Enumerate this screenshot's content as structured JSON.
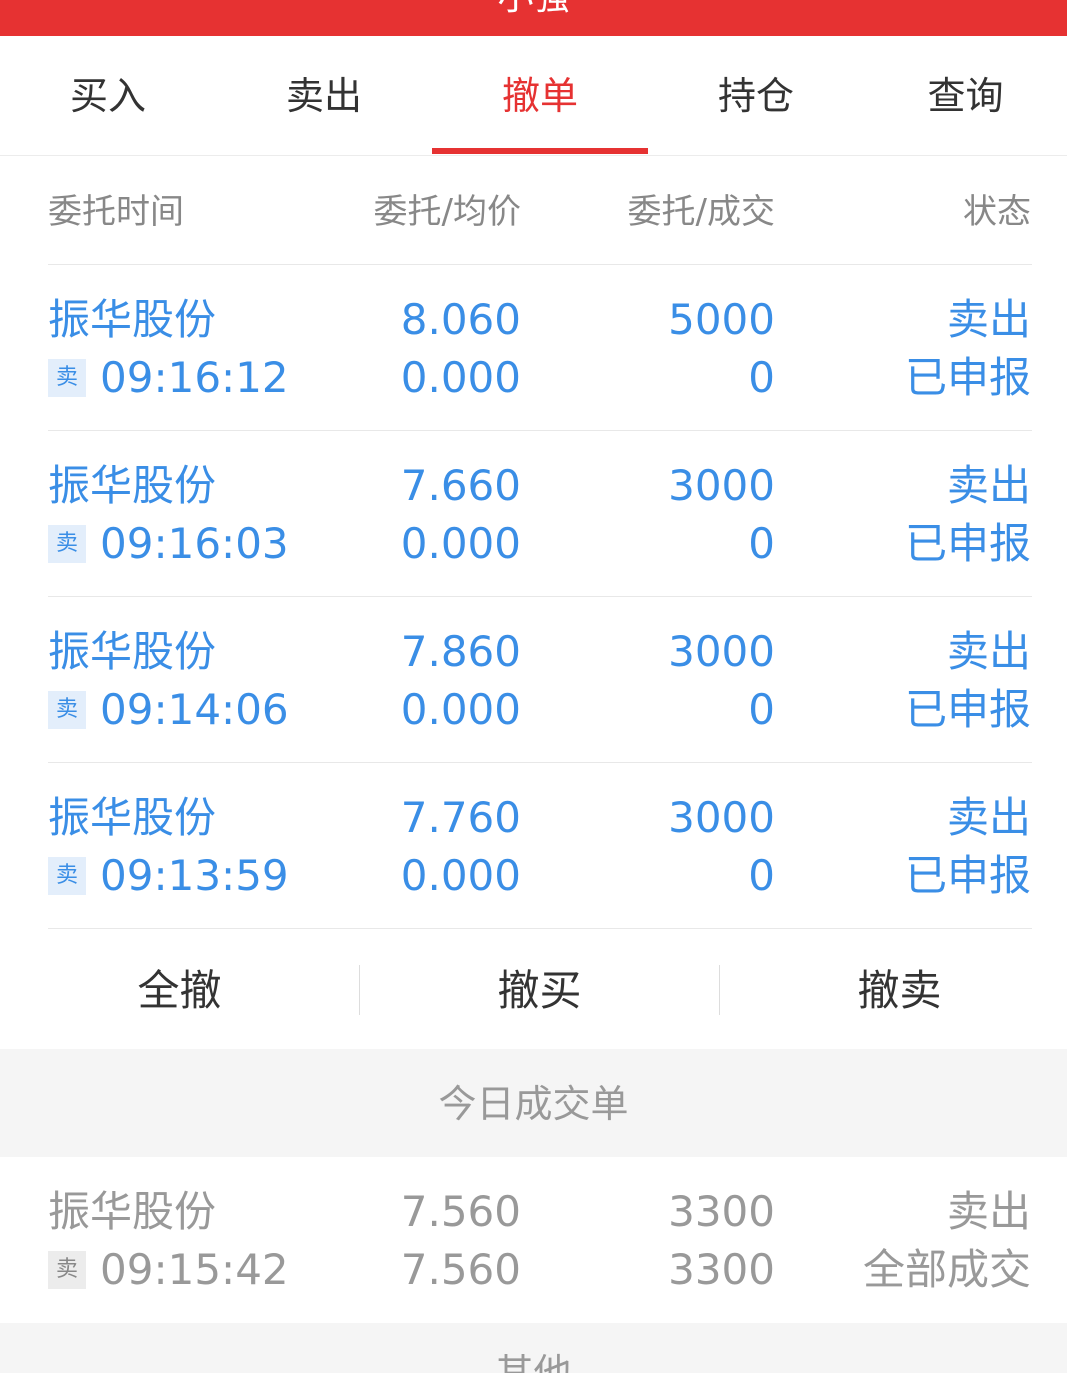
{
  "header": {
    "title": "小强",
    "bg_color": "#e63232"
  },
  "tabs": [
    {
      "label": "买入"
    },
    {
      "label": "卖出"
    },
    {
      "label": "撤单",
      "active": true
    },
    {
      "label": "持仓"
    },
    {
      "label": "查询"
    }
  ],
  "columns": {
    "time": "委托时间",
    "price": "委托/均价",
    "qty": "委托/成交",
    "status": "状态"
  },
  "orders": [
    {
      "name": "振华股份",
      "side_badge": "卖",
      "time": "09:16:12",
      "order_price": "8.060",
      "avg_price": "0.000",
      "order_qty": "5000",
      "filled_qty": "0",
      "direction": "卖出",
      "status": "已申报"
    },
    {
      "name": "振华股份",
      "side_badge": "卖",
      "time": "09:16:03",
      "order_price": "7.660",
      "avg_price": "0.000",
      "order_qty": "3000",
      "filled_qty": "0",
      "direction": "卖出",
      "status": "已申报"
    },
    {
      "name": "振华股份",
      "side_badge": "卖",
      "time": "09:14:06",
      "order_price": "7.860",
      "avg_price": "0.000",
      "order_qty": "3000",
      "filled_qty": "0",
      "direction": "卖出",
      "status": "已申报"
    },
    {
      "name": "振华股份",
      "side_badge": "卖",
      "time": "09:13:59",
      "order_price": "7.760",
      "avg_price": "0.000",
      "order_qty": "3000",
      "filled_qty": "0",
      "direction": "卖出",
      "status": "已申报"
    }
  ],
  "actions": {
    "cancel_all": "全撤",
    "cancel_buy": "撤买",
    "cancel_sell": "撤卖"
  },
  "today_trades": {
    "title": "今日成交单",
    "items": [
      {
        "name": "振华股份",
        "side_badge": "卖",
        "time": "09:15:42",
        "order_price": "7.560",
        "avg_price": "7.560",
        "order_qty": "3300",
        "filled_qty": "3300",
        "direction": "卖出",
        "status": "全部成交"
      }
    ]
  },
  "other_section": {
    "title": "其他"
  },
  "colors": {
    "accent_red": "#e63232",
    "order_blue": "#3a8ee6",
    "done_gray": "#999999"
  }
}
